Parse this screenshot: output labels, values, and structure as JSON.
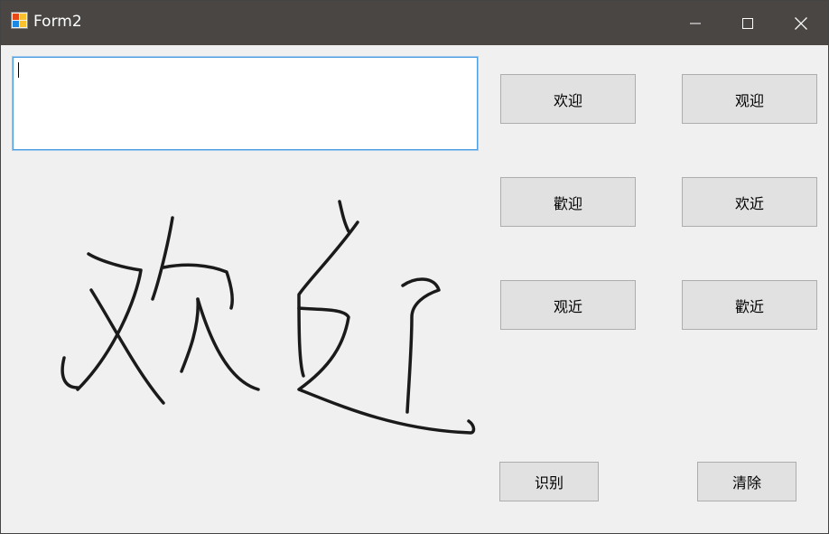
{
  "window": {
    "title": "Form2",
    "titlebar_color": "#494644",
    "background_color": "#f0f0f0"
  },
  "icons": {
    "app": "form-app-icon",
    "minimize": "minimize-icon",
    "maximize": "maximize-icon",
    "close": "close-icon"
  },
  "input": {
    "value": ""
  },
  "candidates": [
    {
      "label": "欢迎"
    },
    {
      "label": "观迎"
    },
    {
      "label": "歡迎"
    },
    {
      "label": "欢近"
    },
    {
      "label": "观近"
    },
    {
      "label": "歡近"
    }
  ],
  "actions": {
    "recognize_label": "识别",
    "clear_label": "清除"
  },
  "canvas": {
    "handwriting": "欢迎"
  }
}
